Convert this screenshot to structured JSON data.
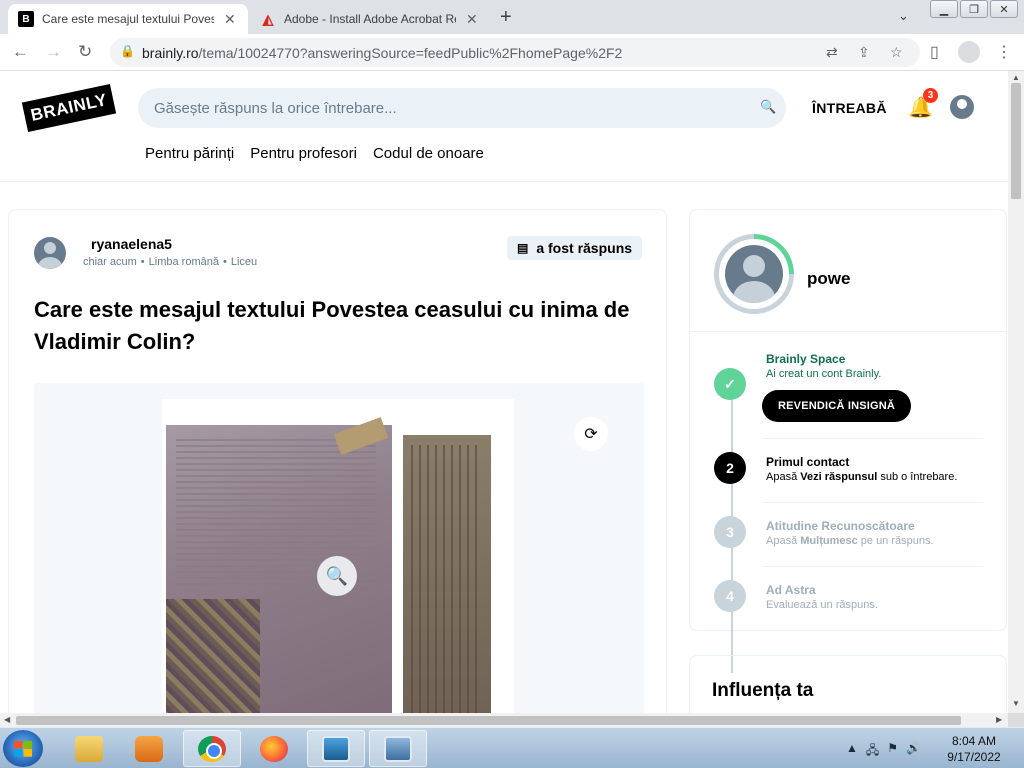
{
  "browser": {
    "tabs": [
      {
        "title": "Care este mesajul textului Povestea",
        "favicon": "brainly-favicon",
        "active": true
      },
      {
        "title": "Adobe - Install Adobe Acrobat Re",
        "favicon": "adobe-favicon",
        "active": false
      }
    ],
    "url_domain": "brainly.ro",
    "url_path": "/tema/10024770?answeringSource=feedPublic%2FhomePage%2F2"
  },
  "header": {
    "logo": "BRAINLY",
    "search_placeholder": "Găsește răspuns la orice întrebare...",
    "ask_label": "ÎNTREABĂ",
    "notification_count": "3",
    "nav": [
      "Pentru părinți",
      "Pentru profesori",
      "Codul de onoare"
    ]
  },
  "question": {
    "author": "ryanaelena5",
    "time": "chiar acum",
    "subject": "Limba română",
    "level": "Liceu",
    "status": "a fost răspuns",
    "title": "Care este mesajul textului Povestea ceasului cu inima de Vladimir Colin?"
  },
  "profile": {
    "name": "powe",
    "progress": 0.25,
    "claim_label": "REVENDICĂ INSIGNĂ",
    "steps": [
      {
        "number": "",
        "title": "Brainly Space",
        "desc": "Ai creat un cont Brainly.",
        "state": "done"
      },
      {
        "number": "2",
        "title": "Primul contact",
        "desc_pre": "Apasă ",
        "desc_bold": "Vezi răspunsul",
        "desc_post": " sub o întrebare.",
        "state": "current"
      },
      {
        "number": "3",
        "title": "Atitudine Recunoscătoare",
        "desc_pre": "Apasă ",
        "desc_bold": "Mulțumesc",
        "desc_post": " pe un răspuns.",
        "state": "todo"
      },
      {
        "number": "4",
        "title": "Ad Astra",
        "desc": "Evaluează un răspuns.",
        "state": "todo"
      }
    ]
  },
  "influence": {
    "title": "Influența ta"
  },
  "taskbar": {
    "time": "8:04 AM",
    "date": "9/17/2022"
  },
  "colors": {
    "accent_green": "#60d399",
    "badge_red": "#ff341a",
    "search_bg": "#ebf2f7"
  }
}
